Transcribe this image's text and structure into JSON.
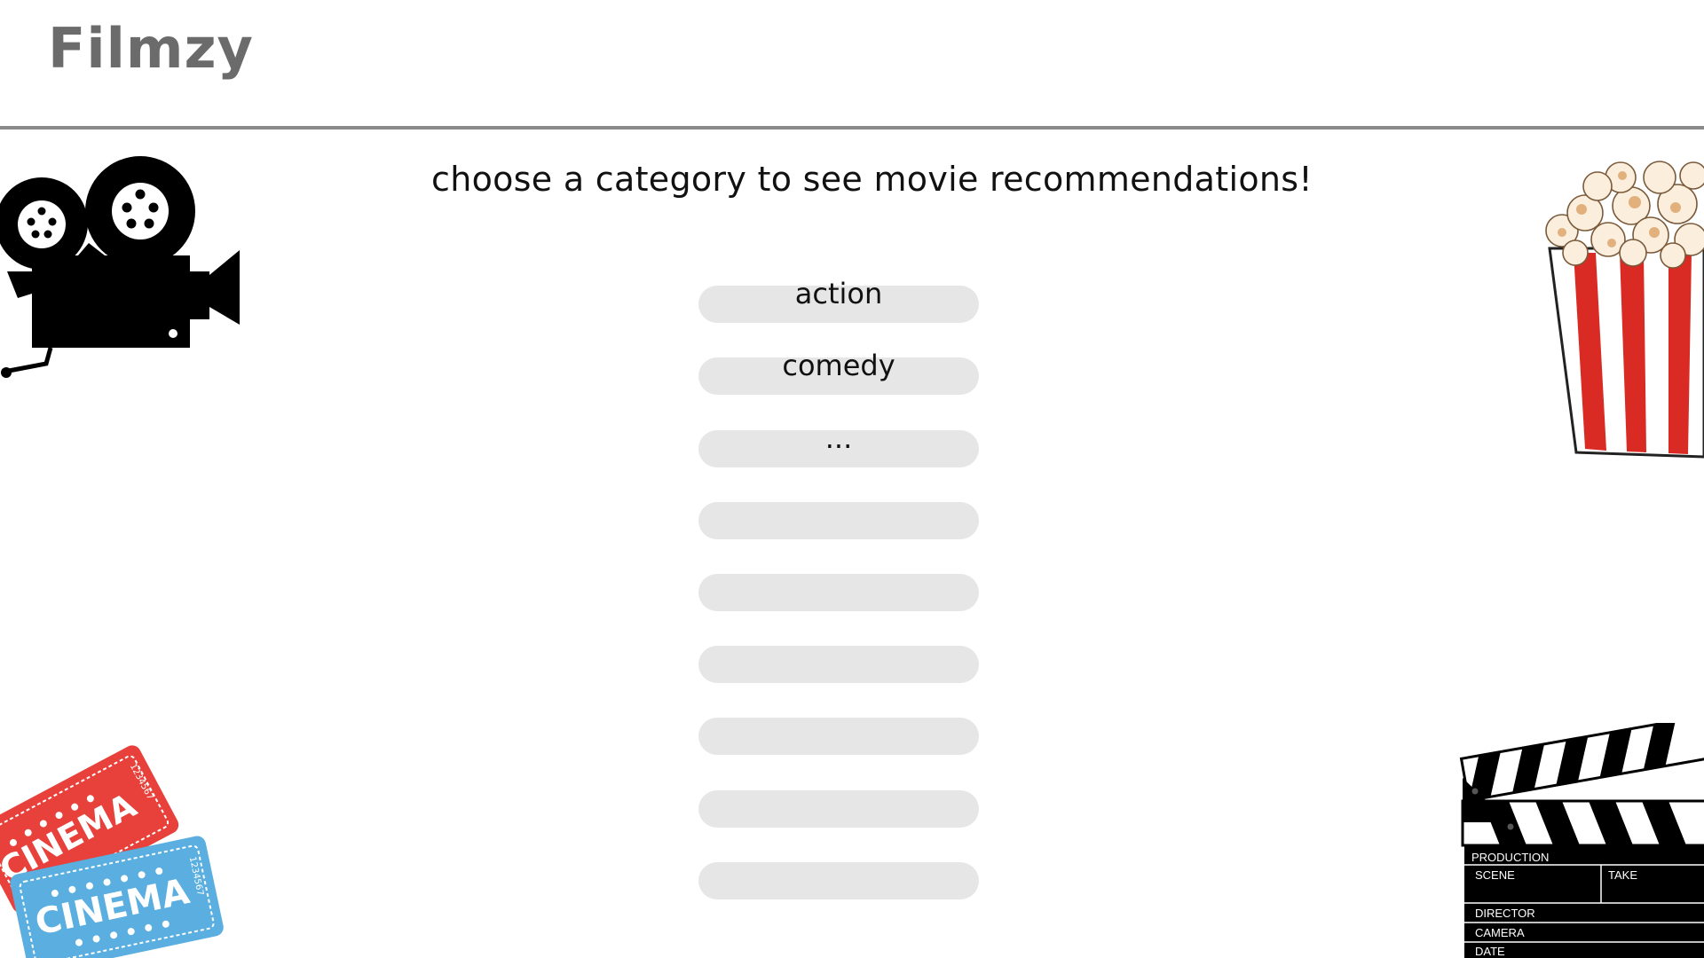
{
  "app": {
    "logo": "Filmzy"
  },
  "main": {
    "headline": "choose a category to see movie recommendations!",
    "categories": [
      {
        "label": "action"
      },
      {
        "label": "comedy"
      },
      {
        "label": "..."
      },
      {
        "label": ""
      },
      {
        "label": ""
      },
      {
        "label": ""
      },
      {
        "label": ""
      },
      {
        "label": ""
      },
      {
        "label": ""
      }
    ]
  },
  "decor": {
    "camera_icon": "movie-camera-icon",
    "popcorn_icon": "popcorn-bucket-icon",
    "tickets": {
      "icon": "cinema-tickets-icon",
      "text": "CINEMA",
      "serial": "1234567"
    },
    "clapperboard": {
      "icon": "clapperboard-icon",
      "fields": [
        "PRODUCTION",
        "SCENE",
        "TAKE",
        "DIRECTOR",
        "CAMERA",
        "DATE"
      ]
    }
  },
  "colors": {
    "accent_divider": "#8a8a8a",
    "pill_background": "#e6e6e6",
    "logo": "#6b6b6b",
    "ticket_red": "#e8403a",
    "ticket_blue": "#5aaee0",
    "popcorn_red": "#d92b23"
  }
}
